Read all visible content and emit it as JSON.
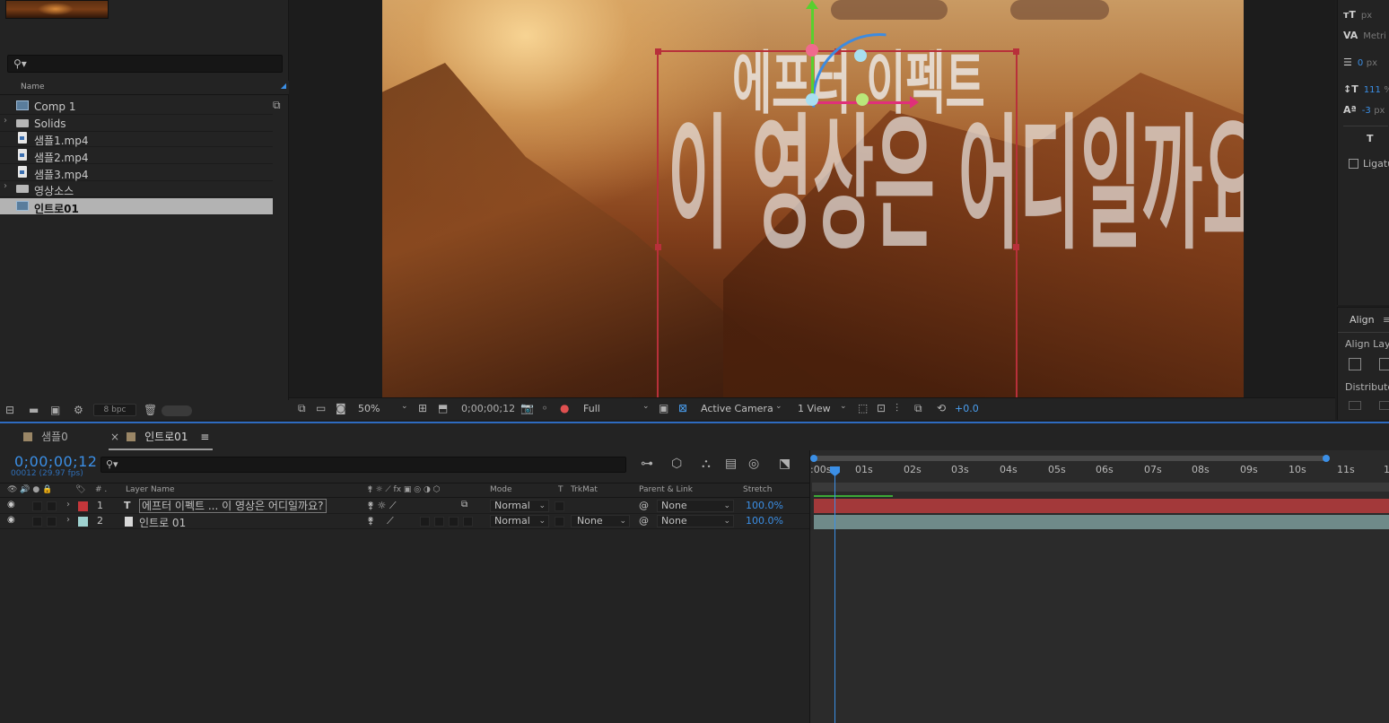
{
  "project": {
    "column_name": "Name",
    "items": [
      {
        "name": "Comp 1",
        "type": "comp",
        "twirl": ""
      },
      {
        "name": "Solids",
        "type": "folder",
        "twirl": "›"
      },
      {
        "name": "샘플1.mp4",
        "type": "file",
        "twirl": ""
      },
      {
        "name": "샘플2.mp4",
        "type": "file",
        "twirl": ""
      },
      {
        "name": "샘플3.mp4",
        "type": "file",
        "twirl": ""
      },
      {
        "name": "영상소스",
        "type": "folder",
        "twirl": "›"
      },
      {
        "name": "인트로01",
        "type": "comp",
        "twirl": "",
        "selected": true
      }
    ],
    "bpc": "8 bpc"
  },
  "viewer": {
    "overlay_text_lines": [
      "에프터 이펙트",
      "이 영상은 어디일까요?"
    ],
    "zoom": "50%",
    "timecode": "0;00;00;12",
    "resolution": "Full",
    "camera": "Active Camera",
    "views": "1 View",
    "exposure": "+0.0"
  },
  "character": {
    "font_size_unit": "px",
    "kerning": "Metri",
    "leading_value": "0",
    "leading_unit": "px",
    "vscale": "111",
    "vscale_unit": "%",
    "baseline": "-3",
    "baseline_unit": "px",
    "ligatures": "Ligatu"
  },
  "align": {
    "tab": "Align",
    "align_layers_to": "Align Laye",
    "distribute": "Distribute"
  },
  "timeline": {
    "tabs": [
      {
        "label": "샘플0",
        "active": false
      },
      {
        "label": "인트로01",
        "active": true
      }
    ],
    "timecode": "0;00;00;12",
    "frame_info": "00012 (29.97 fps)",
    "columns": {
      "name": "Layer Name",
      "mode": "Mode",
      "t": "T",
      "trkmat": "TrkMat",
      "parent": "Parent & Link",
      "stretch": "Stretch"
    },
    "layers": [
      {
        "num": "1",
        "type_icon": "T",
        "name": "에프터 이펙트 ... 이 영상은 어디일까요?",
        "mode": "Normal",
        "trkmat": "",
        "parent": "None",
        "stretch": "100.0%",
        "label_color": "#c4363a"
      },
      {
        "num": "2",
        "type_icon": "",
        "name": "인트로 01",
        "mode": "Normal",
        "trkmat": "None",
        "parent": "None",
        "stretch": "100.0%",
        "label_color": "#9ed1cf"
      }
    ],
    "ruler_ticks": [
      ":00s",
      "01s",
      "02s",
      "03s",
      "04s",
      "05s",
      "06s",
      "07s",
      "08s",
      "09s",
      "10s",
      "11s",
      "1"
    ]
  },
  "colors": {
    "accent_blue": "#3b8fe6",
    "selection_red": "#b8303a",
    "layer1_bar": "#a3393a",
    "layer2_bar": "#6f8a89"
  }
}
